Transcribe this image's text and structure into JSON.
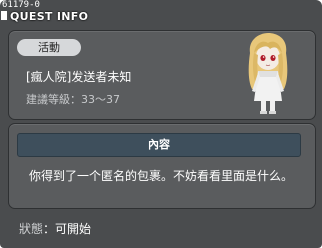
{
  "window": {
    "quest_id": "61179-0",
    "title": "QUEST INFO"
  },
  "summary": {
    "tag": "活動",
    "quest_name": "[瘋人院]发送者未知",
    "level_label": "建議等級",
    "level_range": "33～37",
    "npc_icon": "npc-portrait"
  },
  "content": {
    "header": "內容",
    "text": "你得到了一个匿名的包裹。不妨看看里面是什么。"
  },
  "status": {
    "label": "狀態",
    "value": "可開始"
  },
  "colors": {
    "window_bg": "#4a4c4e",
    "panel_bg": "#5a5c5e",
    "header_bg": "#3e4f5c",
    "pill_bg": "#d6d8da"
  }
}
